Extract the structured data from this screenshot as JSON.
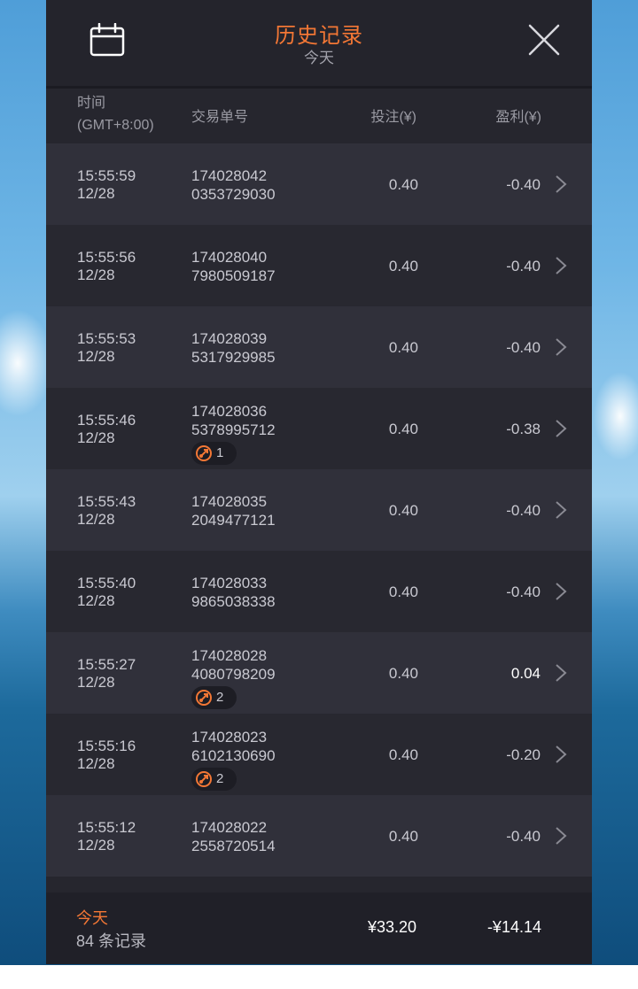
{
  "header": {
    "title": "历史记录",
    "subtitle": "今天",
    "calendar_icon": "calendar-icon",
    "close_icon": "close-icon"
  },
  "columns": {
    "time": "时间",
    "timezone": "(GMT+8:00)",
    "order": "交易单号",
    "bet": "投注(¥)",
    "profit": "盈利(¥)"
  },
  "rows": [
    {
      "time": "15:55:59",
      "date": "12/28",
      "order1": "174028042",
      "order2": "0353729030",
      "badge": null,
      "bet": "0.40",
      "profit": "-0.40"
    },
    {
      "time": "15:55:56",
      "date": "12/28",
      "order1": "174028040",
      "order2": "7980509187",
      "badge": null,
      "bet": "0.40",
      "profit": "-0.40"
    },
    {
      "time": "15:55:53",
      "date": "12/28",
      "order1": "174028039",
      "order2": "5317929985",
      "badge": null,
      "bet": "0.40",
      "profit": "-0.40"
    },
    {
      "time": "15:55:46",
      "date": "12/28",
      "order1": "174028036",
      "order2": "5378995712",
      "badge": "1",
      "bet": "0.40",
      "profit": "-0.38"
    },
    {
      "time": "15:55:43",
      "date": "12/28",
      "order1": "174028035",
      "order2": "2049477121",
      "badge": null,
      "bet": "0.40",
      "profit": "-0.40"
    },
    {
      "time": "15:55:40",
      "date": "12/28",
      "order1": "174028033",
      "order2": "9865038338",
      "badge": null,
      "bet": "0.40",
      "profit": "-0.40"
    },
    {
      "time": "15:55:27",
      "date": "12/28",
      "order1": "174028028",
      "order2": "4080798209",
      "badge": "2",
      "bet": "0.40",
      "profit": "0.04"
    },
    {
      "time": "15:55:16",
      "date": "12/28",
      "order1": "174028023",
      "order2": "6102130690",
      "badge": "2",
      "bet": "0.40",
      "profit": "-0.20"
    },
    {
      "time": "15:55:12",
      "date": "12/28",
      "order1": "174028022",
      "order2": "2558720514",
      "badge": null,
      "bet": "0.40",
      "profit": "-0.40"
    }
  ],
  "footer": {
    "label": "今天",
    "count": "84 条记录",
    "total_bet": "¥33.20",
    "total_profit": "-¥14.14"
  },
  "colors": {
    "accent": "#f37735",
    "panel": "#26262e",
    "row_odd": "#30303a",
    "row_even": "#282830",
    "footer": "#202028"
  },
  "icons": {
    "row_chevron": "chevron-right-icon",
    "badge": "free-spin-icon"
  }
}
